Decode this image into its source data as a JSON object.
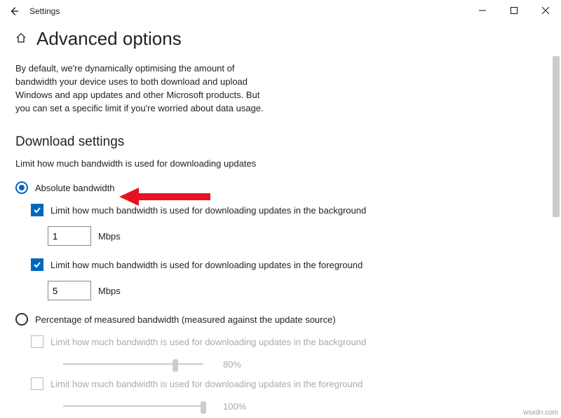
{
  "titlebar": {
    "app_name": "Settings"
  },
  "page": {
    "title": "Advanced options",
    "description": "By default, we're dynamically optimising the amount of bandwidth your device uses to both download and upload Windows and app updates and other Microsoft products. But you can set a specific limit if you're worried about data usage."
  },
  "download": {
    "section_title": "Download settings",
    "subtitle": "Limit how much bandwidth is used for downloading updates",
    "radio_absolute": "Absolute bandwidth",
    "check_background": "Limit how much bandwidth is used for downloading updates in the background",
    "background_value": "1",
    "background_unit": "Mbps",
    "check_foreground": "Limit how much bandwidth is used for downloading updates in the foreground",
    "foreground_value": "5",
    "foreground_unit": "Mbps",
    "radio_percentage": "Percentage of measured bandwidth (measured against the update source)",
    "pct_check_background": "Limit how much bandwidth is used for downloading updates in the background",
    "pct_background_value": "80%",
    "pct_check_foreground": "Limit how much bandwidth is used for downloading updates in the foreground",
    "pct_foreground_value": "100%"
  },
  "watermark": "wsxdn.com"
}
